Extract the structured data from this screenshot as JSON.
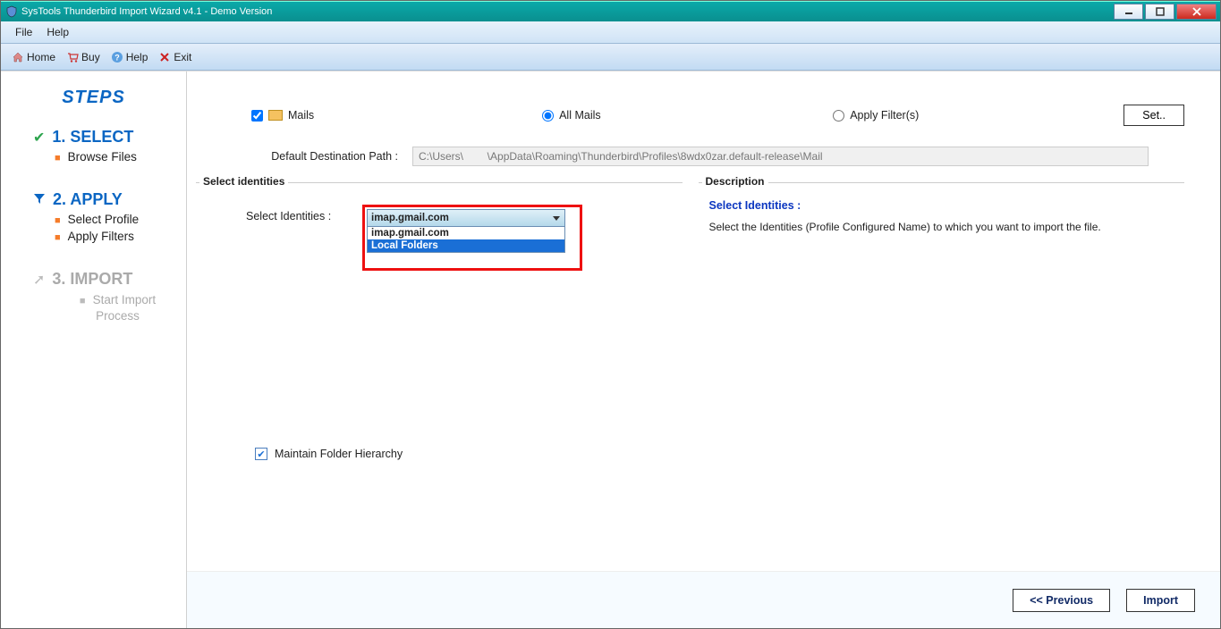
{
  "window": {
    "title": "SysTools Thunderbird Import Wizard v4.1 - Demo Version"
  },
  "menubar": {
    "file": "File",
    "help": "Help"
  },
  "toolbar": {
    "home": "Home",
    "buy": "Buy",
    "help": "Help",
    "exit": "Exit"
  },
  "sidebar": {
    "title": "STEPS",
    "steps": [
      {
        "num": "1. SELECT",
        "subs": [
          "Browse Files"
        ]
      },
      {
        "num": "2. APPLY",
        "subs": [
          "Select Profile",
          "Apply Filters"
        ]
      },
      {
        "num": "3. IMPORT",
        "subs": [
          "Start Import Process"
        ]
      }
    ]
  },
  "content": {
    "mails_label": "Mails",
    "all_mails": "All Mails",
    "apply_filters": "Apply Filter(s)",
    "set_btn": "Set..",
    "dest_label": "Default Destination Path :",
    "dest_value": "C:\\Users\\        \\AppData\\Roaming\\Thunderbird\\Profiles\\8wdx0zar.default-release\\Mail",
    "select_identities_legend": "Select identities",
    "select_identities_label": "Select Identities :",
    "combo_selected": "imap.gmail.com",
    "combo_items": [
      "imap.gmail.com",
      "Local Folders"
    ],
    "description_legend": "Description",
    "desc_title": "Select Identities :",
    "desc_text": "Select the Identities (Profile Configured Name) to  which  you want to import the file.",
    "maintain": "Maintain Folder Hierarchy"
  },
  "footer": {
    "prev": "<< Previous",
    "import": "Import"
  }
}
